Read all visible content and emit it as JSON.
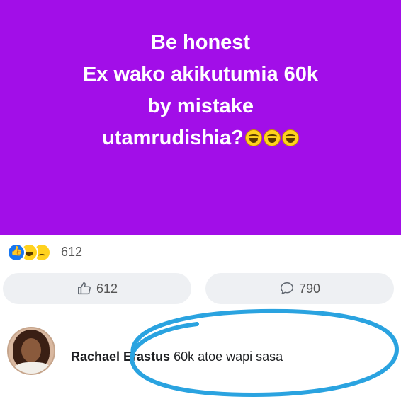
{
  "post": {
    "lines": [
      "Be honest",
      "Ex wako akikutumia 60k",
      "by mistake",
      "utamrudishia?"
    ],
    "emoji_count": 3,
    "background_color": "#a20ee8"
  },
  "reactions": {
    "icons": [
      "like-icon",
      "haha-icon",
      "sad-icon"
    ],
    "count": "612"
  },
  "actions": {
    "like_count": "612",
    "comment_count": "790"
  },
  "comment": {
    "author": "Rachael Erastus",
    "text": "60k atoe wapi sasa",
    "annotation_color": "#2aa3e0"
  }
}
